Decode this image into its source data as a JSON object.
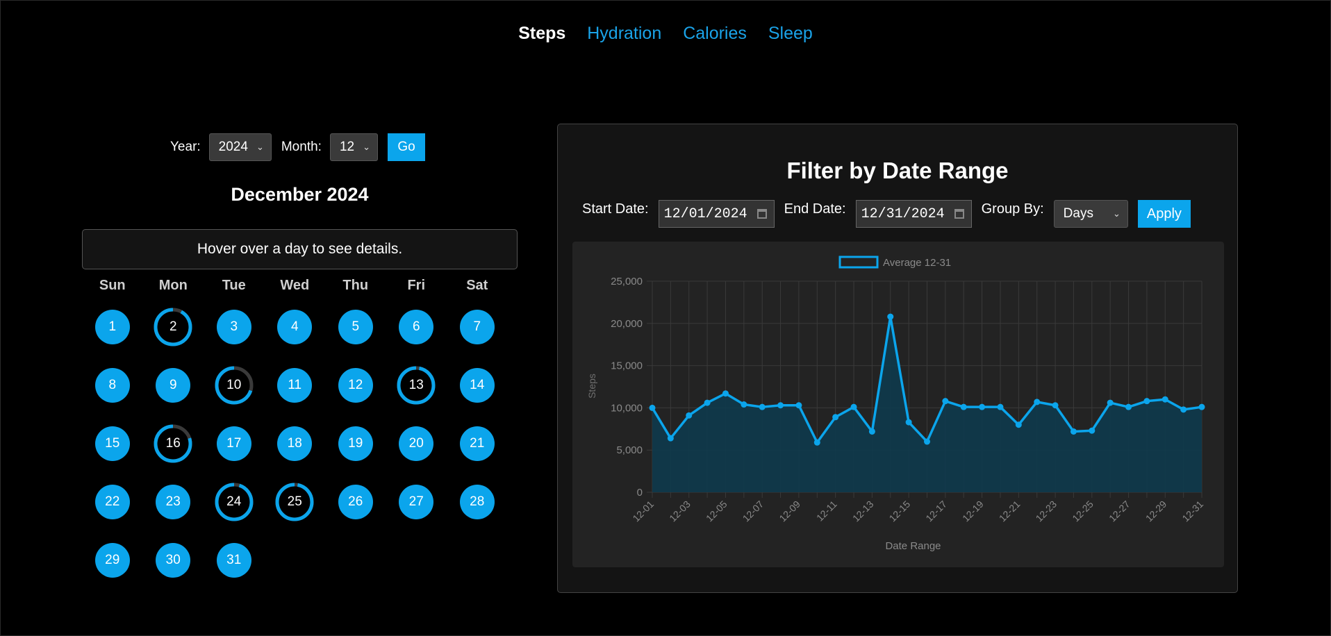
{
  "nav": [
    {
      "label": "Steps",
      "active": true
    },
    {
      "label": "Hydration",
      "active": false
    },
    {
      "label": "Calories",
      "active": false
    },
    {
      "label": "Sleep",
      "active": false
    }
  ],
  "calendar": {
    "year_label": "Year:",
    "year_value": "2024",
    "month_label": "Month:",
    "month_value": "12",
    "go_label": "Go",
    "title": "December 2024",
    "hover_text": "Hover over a day to see details.",
    "weekdays": [
      "Sun",
      "Mon",
      "Tue",
      "Wed",
      "Thu",
      "Fri",
      "Sat"
    ],
    "first_weekday": 0,
    "days_in_month": 31,
    "ring_days": [
      {
        "day": 2,
        "progress": 0.92
      },
      {
        "day": 10,
        "progress": 0.7
      },
      {
        "day": 13,
        "progress": 0.97
      },
      {
        "day": 16,
        "progress": 0.8
      },
      {
        "day": 24,
        "progress": 0.95
      },
      {
        "day": 25,
        "progress": 0.97
      }
    ]
  },
  "filter": {
    "title": "Filter by Date Range",
    "start_label": "Start Date:",
    "start_value": "12/01/2024",
    "end_label": "End Date:",
    "end_value": "12/31/2024",
    "group_label": "Group By:",
    "group_value": "Days",
    "apply_label": "Apply"
  },
  "colors": {
    "accent": "#0ba5ec",
    "ring_track": "#3a3a3a",
    "area_fill": "#0e3a4d"
  },
  "chart_data": {
    "type": "area",
    "legend_label": "Average 12-31",
    "legend_position": "top",
    "xlabel": "Date Range",
    "ylabel": "Steps",
    "ylim": [
      0,
      25000
    ],
    "yticks": [
      "0",
      "5,000",
      "10,000",
      "15,000",
      "20,000",
      "25,000"
    ],
    "ytick_values": [
      0,
      5000,
      10000,
      15000,
      20000,
      25000
    ],
    "x": [
      "12-01",
      "12-02",
      "12-03",
      "12-04",
      "12-05",
      "12-06",
      "12-07",
      "12-08",
      "12-09",
      "12-10",
      "12-11",
      "12-12",
      "12-13",
      "12-14",
      "12-15",
      "12-16",
      "12-17",
      "12-18",
      "12-19",
      "12-20",
      "12-21",
      "12-22",
      "12-23",
      "12-24",
      "12-25",
      "12-26",
      "12-27",
      "12-28",
      "12-29",
      "12-30",
      "12-31"
    ],
    "xtick_labels": [
      "12-01",
      "12-03",
      "12-05",
      "12-07",
      "12-09",
      "12-11",
      "12-13",
      "12-15",
      "12-17",
      "12-19",
      "12-21",
      "12-23",
      "12-25",
      "12-27",
      "12-29",
      "12-31"
    ],
    "values": [
      10000,
      6400,
      9100,
      10600,
      11700,
      10400,
      10100,
      10300,
      10300,
      5900,
      8900,
      10100,
      7200,
      20800,
      8300,
      6000,
      10800,
      10100,
      10100,
      10100,
      8000,
      10700,
      10300,
      7200,
      7300,
      10600,
      10100,
      10800,
      11000,
      9800,
      10100
    ],
    "grid": true
  }
}
